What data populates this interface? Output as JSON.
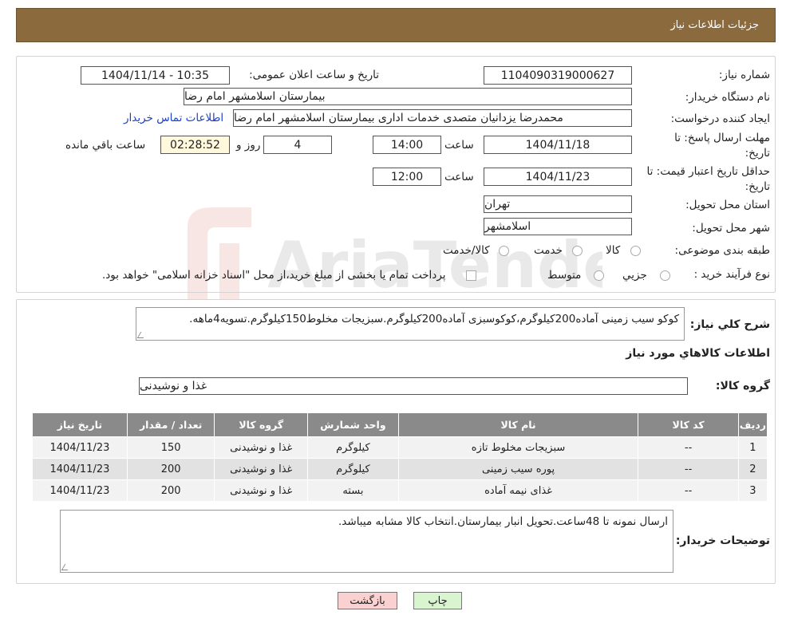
{
  "header": {
    "title": "جزئیات اطلاعات نیاز"
  },
  "form": {
    "need_number_label": "شماره نیاز:",
    "need_number": "1104090319000627",
    "announce_label": "تاریخ و ساعت اعلان عمومی:",
    "announce_value": "1404/11/14 - 10:35",
    "buyer_org_label": "نام دستگاه خریدار:",
    "buyer_org": "بیمارستان اسلامشهر   امام رضا",
    "creator_label": "ایجاد کننده درخواست:",
    "creator": "محمدرضا یزدانیان متصدی خدمات اداری بیمارستان اسلامشهر   امام رضا",
    "contact_link": "اطلاعات تماس خریدار",
    "deadline_label_1": "مهلت ارسال پاسخ: تا",
    "deadline_label_2": "تاریخ:",
    "deadline_date": "1404/11/18",
    "time_label": "ساعت",
    "deadline_time": "14:00",
    "days_value": "4",
    "days_label": "روز و",
    "remaining_time": "02:28:52",
    "remaining_label": "ساعت باقي مانده",
    "validity_label_1": "حداقل تاریخ اعتبار قیمت: تا",
    "validity_label_2": "تاریخ:",
    "validity_date": "1404/11/23",
    "validity_time": "12:00",
    "province_label": "استان محل تحویل:",
    "province": "تهران",
    "city_label": "شهر محل تحویل:",
    "city": "اسلامشهر",
    "category_label": "طبقه بندی موضوعی:",
    "category_options": [
      "کالا",
      "خدمت",
      "کالا/خدمت"
    ],
    "process_label": "نوع فرآیند خرید :",
    "process_options": [
      "جزیي",
      "متوسط"
    ],
    "process_note": "پرداخت تمام یا بخشی از مبلغ خرید،از محل \"اسناد خزانه اسلامی\" خواهد بود."
  },
  "description": {
    "label": "شرح كلي نياز:",
    "text": "کوکو سیب زمینی آماده200کیلوگرم،کوکوسبزی آماده200کیلوگرم.سبزیجات مخلوط150کیلوگرم.تسویه4ماهه."
  },
  "goods": {
    "section_title": "اطلاعات كالاهاي مورد نياز",
    "group_label": "گروه کالا:",
    "group_value": "غذا و نوشیدنی",
    "columns": [
      "ردیف",
      "کد کالا",
      "نام کالا",
      "واحد شمارش",
      "گروه کالا",
      "تعداد / مقدار",
      "تاریخ نیاز"
    ],
    "rows": [
      [
        "1",
        "--",
        "سبزیجات مخلوط تازه",
        "کیلوگرم",
        "غذا و نوشیدنی",
        "150",
        "1404/11/23"
      ],
      [
        "2",
        "--",
        "پوره سیب زمینی",
        "کیلوگرم",
        "غذا و نوشیدنی",
        "200",
        "1404/11/23"
      ],
      [
        "3",
        "--",
        "غذای نیمه آماده",
        "بسته",
        "غذا و نوشیدنی",
        "200",
        "1404/11/23"
      ]
    ]
  },
  "buyer_notes": {
    "label": "توضیحات خریدار:",
    "text": "ارسال نمونه تا 48ساعت.تحویل انبار بیمارستان.انتخاب کالا مشابه میباشد."
  },
  "buttons": {
    "print": "چاپ",
    "back": "بازگشت"
  },
  "watermark": {
    "text": "AriaTender.neT"
  },
  "colors": {
    "header_bg": "#8b6a3e",
    "link": "#1a3fcf",
    "back_button": "#fbd0d0",
    "print_button": "#d8f5d0",
    "table_header": "#8a8a8a",
    "time_box": "#fff8dc"
  }
}
